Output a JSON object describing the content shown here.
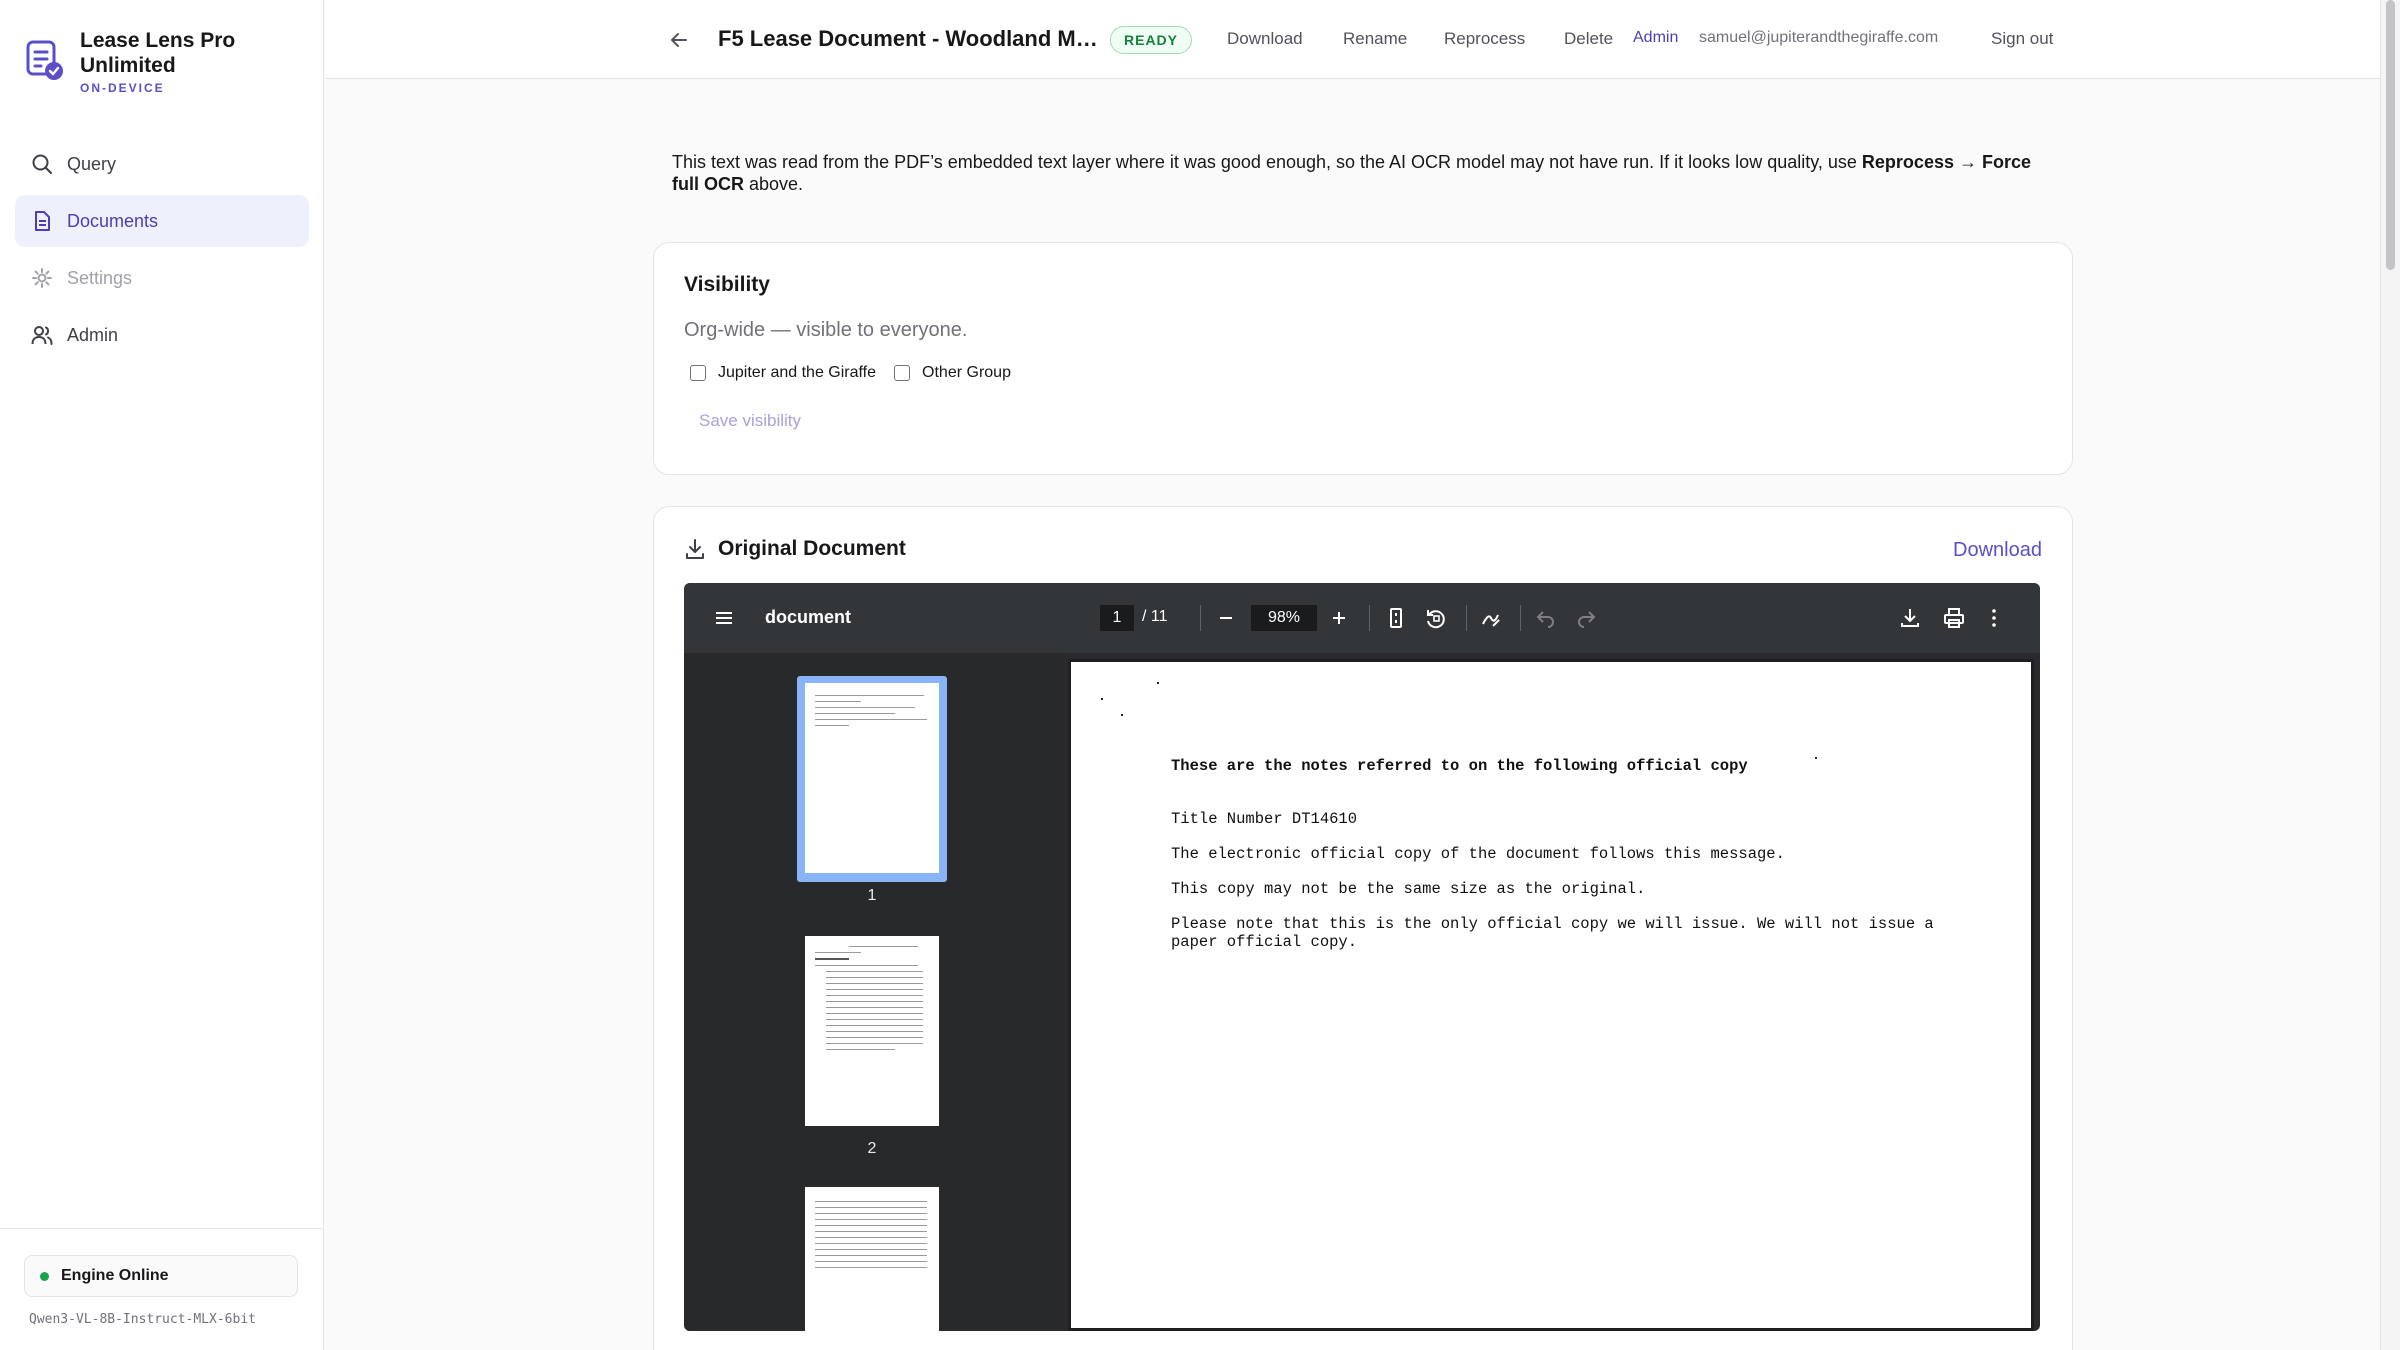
{
  "app": {
    "name": "Lease Lens Pro Unlimited",
    "subtitle": "ON-DEVICE"
  },
  "sidebar": {
    "items": [
      {
        "label": "Query",
        "icon": "search-icon",
        "state": "normal"
      },
      {
        "label": "Documents",
        "icon": "document-icon",
        "state": "active"
      },
      {
        "label": "Settings",
        "icon": "gear-icon",
        "state": "disabled"
      },
      {
        "label": "Admin",
        "icon": "users-icon",
        "state": "normal"
      }
    ],
    "engine_status": "Engine Online",
    "model": "Qwen3-VL-8B-Instruct-MLX-6bit"
  },
  "header": {
    "title": "F5 Lease Document - Woodland Ma...",
    "status": "READY",
    "actions": {
      "download": "Download",
      "rename": "Rename",
      "reprocess": "Reprocess",
      "delete": "Delete"
    },
    "admin_link": "Admin",
    "user_email": "samuel@jupiterandthegiraffe.com",
    "sign_out": "Sign out"
  },
  "notice": {
    "text_before": "This text was read from the PDF’s embedded text layer where it was good enough, so the AI OCR model may not have run. If it looks low quality, use ",
    "emphasis": "Reprocess → Force full OCR",
    "text_after": " above."
  },
  "visibility": {
    "title": "Visibility",
    "description": "Org-wide — visible to everyone.",
    "groups": [
      {
        "label": "Jupiter and the Giraffe",
        "checked": false
      },
      {
        "label": "Other Group",
        "checked": false
      }
    ],
    "save_label": "Save visibility"
  },
  "original_document": {
    "title": "Original Document",
    "download_label": "Download",
    "viewer": {
      "filename": "document",
      "current_page": "1",
      "total_pages": "/  11",
      "zoom": "98%",
      "thumbnails": [
        "1",
        "2"
      ],
      "page_lines": {
        "heading": "These are the notes referred to on the following official copy",
        "title_number": "Title Number DT14610",
        "line1": "The electronic official copy of the document follows this message.",
        "line2": "This copy may not be the same size as the original.",
        "line3": "Please note that this is the only official copy we will issue. We will not issue a",
        "line4": "paper official copy."
      }
    }
  },
  "colors": {
    "accent": "#5b4fc9",
    "active_nav_bg": "#eef0fb",
    "status_green": "#15803d",
    "viewer_bg": "#323639"
  }
}
